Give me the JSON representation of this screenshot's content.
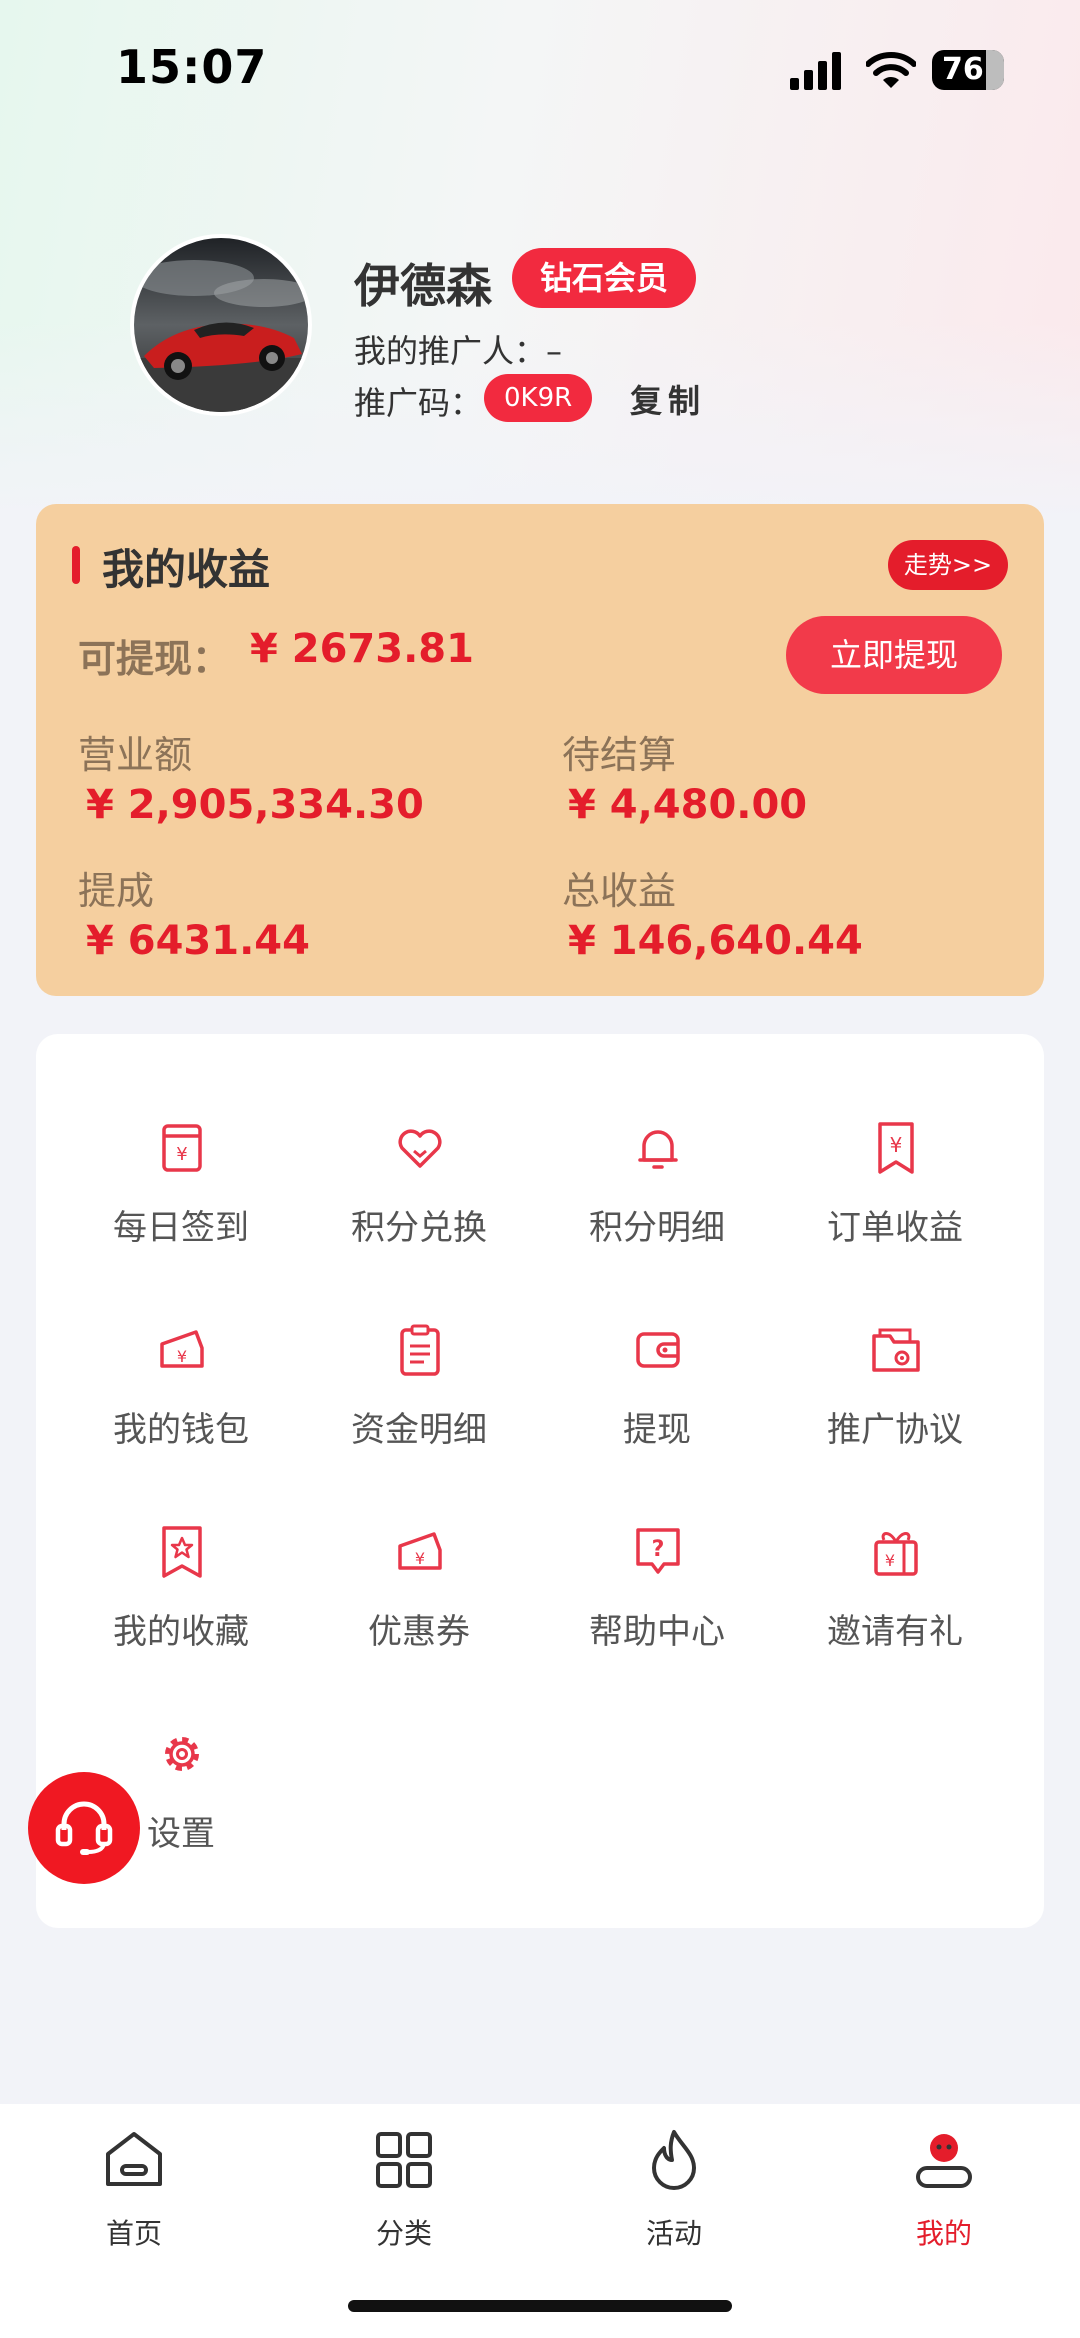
{
  "status_bar": {
    "time": "15:07",
    "battery": "76"
  },
  "profile": {
    "name": "伊德森",
    "vip": "钻石会员",
    "promoter": "我的推广人：–",
    "code_label": "推广码：",
    "code": "0K9R",
    "copy": "复制"
  },
  "earnings": {
    "title": "我的收益",
    "trend": "走势>>",
    "withdrawable_label": "可提现：",
    "withdrawable": "¥ 2673.81",
    "withdraw_button": "立即提现",
    "stats": [
      {
        "label": "营业额",
        "value": "¥ 2,905,334.30"
      },
      {
        "label": "待结算",
        "value": "¥ 4,480.00"
      },
      {
        "label": "提成",
        "value": "¥ 6431.44"
      },
      {
        "label": "总收益",
        "value": "¥ 146,640.44"
      }
    ]
  },
  "menu": [
    {
      "label": "每日签到",
      "icon": "checkin-icon"
    },
    {
      "label": "积分兑换",
      "icon": "heart-icon"
    },
    {
      "label": "积分明细",
      "icon": "bell-icon"
    },
    {
      "label": "订单收益",
      "icon": "bookmark-yen-icon"
    },
    {
      "label": "我的钱包",
      "icon": "wallet-yen-icon"
    },
    {
      "label": "资金明细",
      "icon": "clipboard-icon"
    },
    {
      "label": "提现",
      "icon": "wallet-icon"
    },
    {
      "label": "推广协议",
      "icon": "folder-coin-icon"
    },
    {
      "label": "我的收藏",
      "icon": "star-bookmark-icon"
    },
    {
      "label": "优惠券",
      "icon": "coupon-icon"
    },
    {
      "label": "帮助中心",
      "icon": "help-chat-icon"
    },
    {
      "label": "邀请有礼",
      "icon": "gift-icon"
    },
    {
      "label": "设置",
      "icon": "gear-icon"
    }
  ],
  "tabs": [
    {
      "label": "首页",
      "icon": "home-icon"
    },
    {
      "label": "分类",
      "icon": "grid-icon"
    },
    {
      "label": "活动",
      "icon": "flame-icon"
    },
    {
      "label": "我的",
      "icon": "user-icon"
    }
  ],
  "colors": {
    "accent": "#e41d2b",
    "card": "#f5cf9f",
    "label": "#8c7358"
  }
}
